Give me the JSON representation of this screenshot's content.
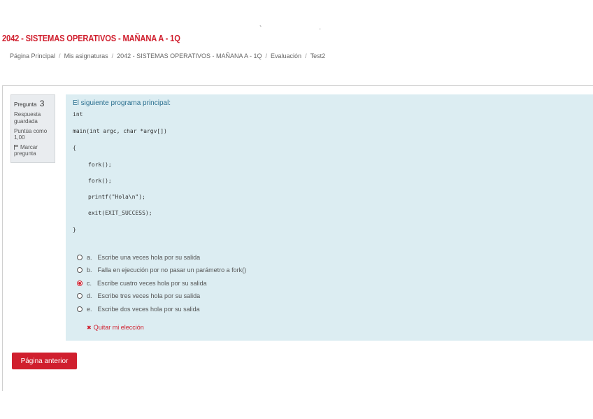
{
  "header": {
    "course_title": "2042 - SISTEMAS OPERATIVOS - MAÑANA A - 1Q",
    "dots": [
      "`",
      "·"
    ]
  },
  "breadcrumb": [
    "Página Principal",
    "Mis asignaturas",
    "2042 - SISTEMAS OPERATIVOS - MAÑANA A - 1Q",
    "Evaluación",
    "Test2"
  ],
  "question_info": {
    "label": "Pregunta",
    "number": "3",
    "status": "Respuesta guardada",
    "score": "Puntúa como 1,00",
    "flag": "Marcar pregunta"
  },
  "question": {
    "prompt": "El siguiente programa principal:",
    "code": [
      "int",
      "main(int argc, char *argv[])",
      "{",
      "fork();",
      "fork();",
      "printf(\"Hola\\n\");",
      "exit(EXIT_SUCCESS);",
      "}"
    ],
    "options": [
      {
        "letter": "a.",
        "text": "Escribe una veces hola por su salida",
        "checked": false
      },
      {
        "letter": "b.",
        "text": "Falla en ejecución por no pasar un parámetro a fork()",
        "checked": false
      },
      {
        "letter": "c.",
        "text": "Escribe cuatro veces hola por su salida",
        "checked": true
      },
      {
        "letter": "d.",
        "text": "Escribe tres veces hola por su salida",
        "checked": false
      },
      {
        "letter": "e.",
        "text": "Escribe dos veces hola por su salida",
        "checked": false
      }
    ],
    "clear_label": "Quitar mi elección"
  },
  "nav": {
    "prev_label": "Página anterior"
  },
  "colors": {
    "accent": "#d01f2e",
    "question_bg": "#dcedf2",
    "info_bg": "#e9ecef"
  }
}
